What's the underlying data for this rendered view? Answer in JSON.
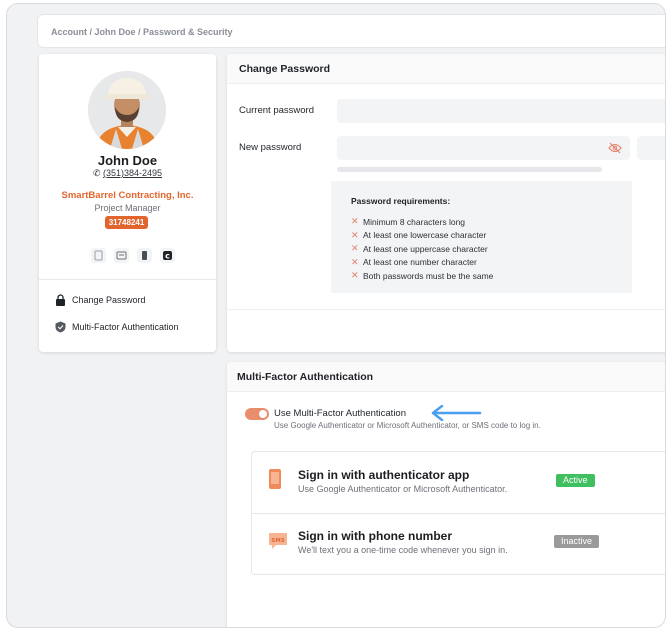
{
  "breadcrumb": "Account / John Doe / Password & Security",
  "profile": {
    "name": "John Doe",
    "phone": "(351)384-2495",
    "company": "SmartBarrel Contracting, Inc.",
    "role": "Project Manager",
    "id_badge": "31748241",
    "quick_icons": [
      "document-icon",
      "id-card-icon",
      "device-icon",
      "brand-logo-icon"
    ]
  },
  "nav": [
    {
      "label": "Change Password",
      "icon": "lock-icon"
    },
    {
      "label": "Multi-Factor Authentication",
      "icon": "shield-icon"
    }
  ],
  "password": {
    "title": "Change Password",
    "current_label": "Current password",
    "new_label": "New password",
    "requirements_title": "Password requirements:",
    "requirements": [
      "Minimum 8 characters long",
      "At least one lowercase character",
      "At least one uppercase character",
      "At least one number character",
      "Both passwords must be the same"
    ]
  },
  "mfa": {
    "title": "Multi-Factor Authentication",
    "toggle_label": "Use Multi-Factor Authentication",
    "toggle_desc": "Use Google Authenticator or Microsoft Authenticator, or SMS code to log in.",
    "toggle_on": true,
    "methods": [
      {
        "title": "Sign in with authenticator app",
        "subtitle": "Use Google Authenticator or Microsoft Authenticator.",
        "status": "Active",
        "status_color": "#3fbf5f"
      },
      {
        "title": "Sign in with phone number",
        "subtitle": "We'll text you a one-time code whenever you sign in.",
        "status": "Inactive",
        "status_color": "#9a9a9a"
      }
    ]
  },
  "colors": {
    "accent": "#e2652e",
    "arrow": "#4b9ef0"
  }
}
